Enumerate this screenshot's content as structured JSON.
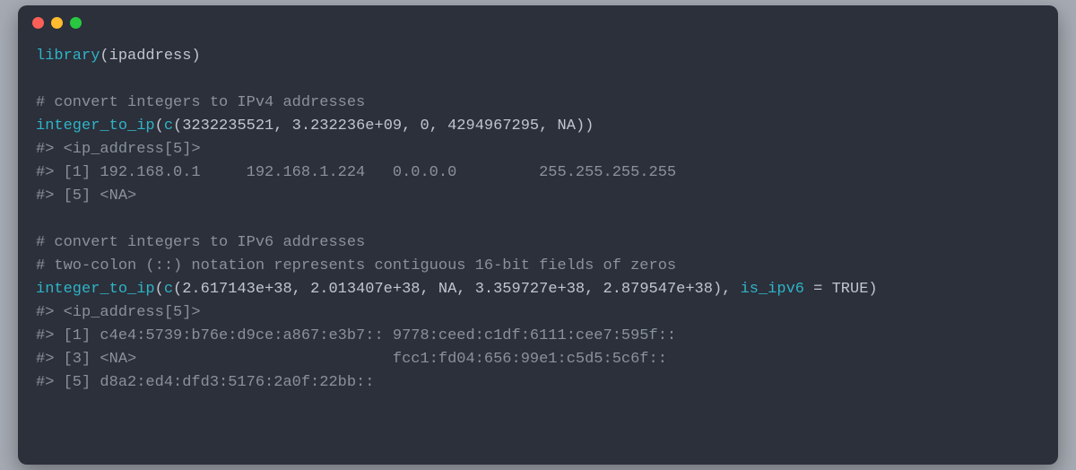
{
  "lines": [
    {
      "segments": [
        {
          "cls": "fn",
          "text": "library"
        },
        {
          "cls": "punc",
          "text": "("
        },
        {
          "cls": "arg",
          "text": "ipaddress"
        },
        {
          "cls": "punc",
          "text": ")"
        }
      ]
    },
    {
      "segments": [
        {
          "cls": "",
          "text": ""
        }
      ]
    },
    {
      "segments": [
        {
          "cls": "comment",
          "text": "# convert integers to IPv4 addresses"
        }
      ]
    },
    {
      "segments": [
        {
          "cls": "fn",
          "text": "integer_to_ip"
        },
        {
          "cls": "punc",
          "text": "("
        },
        {
          "cls": "fn",
          "text": "c"
        },
        {
          "cls": "punc",
          "text": "("
        },
        {
          "cls": "num",
          "text": "3232235521"
        },
        {
          "cls": "punc",
          "text": ", "
        },
        {
          "cls": "num",
          "text": "3.232236e+09"
        },
        {
          "cls": "punc",
          "text": ", "
        },
        {
          "cls": "num",
          "text": "0"
        },
        {
          "cls": "punc",
          "text": ", "
        },
        {
          "cls": "num",
          "text": "4294967295"
        },
        {
          "cls": "punc",
          "text": ", "
        },
        {
          "cls": "na",
          "text": "NA"
        },
        {
          "cls": "punc",
          "text": "))"
        }
      ]
    },
    {
      "segments": [
        {
          "cls": "out",
          "text": "#> <ip_address[5]>"
        }
      ]
    },
    {
      "segments": [
        {
          "cls": "out",
          "text": "#> [1] 192.168.0.1     192.168.1.224   0.0.0.0         255.255.255.255"
        }
      ]
    },
    {
      "segments": [
        {
          "cls": "out",
          "text": "#> [5] <NA>"
        }
      ]
    },
    {
      "segments": [
        {
          "cls": "",
          "text": ""
        }
      ]
    },
    {
      "segments": [
        {
          "cls": "comment",
          "text": "# convert integers to IPv6 addresses"
        }
      ]
    },
    {
      "segments": [
        {
          "cls": "comment",
          "text": "# two-colon (::) notation represents contiguous 16-bit fields of zeros"
        }
      ]
    },
    {
      "segments": [
        {
          "cls": "fn",
          "text": "integer_to_ip"
        },
        {
          "cls": "punc",
          "text": "("
        },
        {
          "cls": "fn",
          "text": "c"
        },
        {
          "cls": "punc",
          "text": "("
        },
        {
          "cls": "num",
          "text": "2.617143e+38"
        },
        {
          "cls": "punc",
          "text": ", "
        },
        {
          "cls": "num",
          "text": "2.013407e+38"
        },
        {
          "cls": "punc",
          "text": ", "
        },
        {
          "cls": "na",
          "text": "NA"
        },
        {
          "cls": "punc",
          "text": ", "
        },
        {
          "cls": "num",
          "text": "3.359727e+38"
        },
        {
          "cls": "punc",
          "text": ", "
        },
        {
          "cls": "num",
          "text": "2.879547e+38"
        },
        {
          "cls": "punc",
          "text": "), "
        },
        {
          "cls": "kwarg",
          "text": "is_ipv6"
        },
        {
          "cls": "punc",
          "text": " = "
        },
        {
          "cls": "const",
          "text": "TRUE"
        },
        {
          "cls": "punc",
          "text": ")"
        }
      ]
    },
    {
      "segments": [
        {
          "cls": "out",
          "text": "#> <ip_address[5]>"
        }
      ]
    },
    {
      "segments": [
        {
          "cls": "out",
          "text": "#> [1] c4e4:5739:b76e:d9ce:a867:e3b7:: 9778:ceed:c1df:6111:cee7:595f::"
        }
      ]
    },
    {
      "segments": [
        {
          "cls": "out",
          "text": "#> [3] <NA>                            fcc1:fd04:656:99e1:c5d5:5c6f::"
        }
      ]
    },
    {
      "segments": [
        {
          "cls": "out",
          "text": "#> [5] d8a2:ed4:dfd3:5176:2a0f:22bb::"
        }
      ]
    }
  ]
}
